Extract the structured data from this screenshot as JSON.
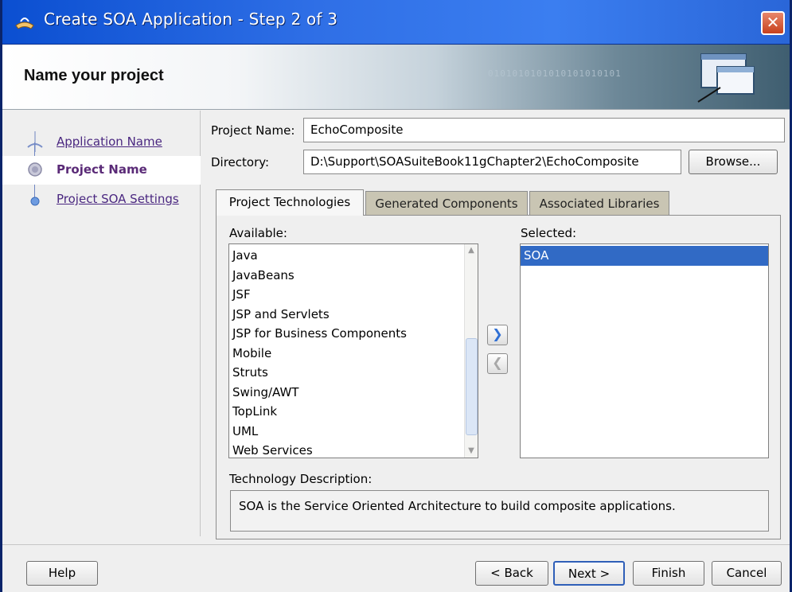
{
  "window": {
    "title": "Create SOA Application - Step 2 of 3",
    "close_glyph": "✕"
  },
  "banner": {
    "heading": "Name your project",
    "binary_decoration": "0101010101010101010101"
  },
  "nav": {
    "items": [
      {
        "label": "Application Name",
        "state": "visited"
      },
      {
        "label": "Project Name",
        "state": "current"
      },
      {
        "label": "Project SOA Settings",
        "state": "next"
      }
    ]
  },
  "form": {
    "project_name_label": "Project Name:",
    "project_name_value": "EchoComposite",
    "directory_label": "Directory:",
    "directory_value": "D:\\Support\\SOASuiteBook11gChapter2\\EchoComposite",
    "browse_label": "Browse..."
  },
  "tabs": [
    {
      "label": "Project Technologies",
      "active": true
    },
    {
      "label": "Generated Components",
      "active": false
    },
    {
      "label": "Associated Libraries",
      "active": false
    }
  ],
  "technologies": {
    "available_label": "Available:",
    "available": [
      "Java",
      "JavaBeans",
      "JSF",
      "JSP and Servlets",
      "JSP for Business Components",
      "Mobile",
      "Struts",
      "Swing/AWT",
      "TopLink",
      "UML",
      "Web Services"
    ],
    "selected_label": "Selected:",
    "selected": [
      "SOA"
    ],
    "add_glyph": "❯",
    "remove_glyph": "❮",
    "description_label": "Technology Description:",
    "description": "SOA is the Service Oriented Architecture to build composite applications."
  },
  "footer": {
    "help": "Help",
    "back": "< Back",
    "next": "Next >",
    "finish": "Finish",
    "cancel": "Cancel"
  },
  "colors": {
    "titlebar": "#2f6fe6",
    "selection": "#316ac5",
    "nav_link": "#4a2780",
    "nav_current": "#5a2a77"
  }
}
